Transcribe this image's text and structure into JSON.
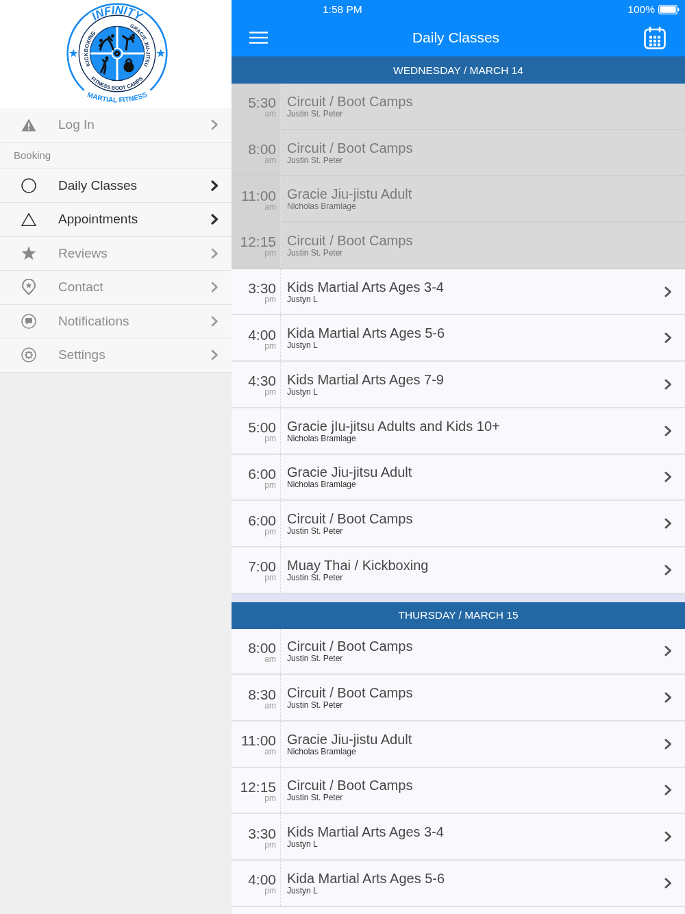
{
  "status_bar": {
    "time": "1:58 PM",
    "battery": "100%"
  },
  "logo": {
    "top_text": "INFINITY",
    "bottom_text": "MARTIAL FITNESS",
    "left_text": "KICKBOXING",
    "lower_text": "FITNESS BOOT CAMPS",
    "right_text": "GRACIE JIU-JITSU"
  },
  "sidebar": {
    "items": [
      {
        "kind": "item",
        "label": "Log In",
        "disabled": true
      },
      {
        "kind": "header",
        "label": "Booking"
      },
      {
        "kind": "item",
        "label": "Daily Classes",
        "disabled": false
      },
      {
        "kind": "item",
        "label": "Appointments",
        "disabled": false
      },
      {
        "kind": "item",
        "label": "Reviews",
        "disabled": true
      },
      {
        "kind": "item",
        "label": "Contact",
        "disabled": true
      },
      {
        "kind": "item",
        "label": "Notifications",
        "disabled": true
      },
      {
        "kind": "item",
        "label": "Settings",
        "disabled": true
      }
    ]
  },
  "nav_bar": {
    "title": "Daily Classes"
  },
  "days": [
    {
      "date": "WEDNESDAY / MARCH 14",
      "classes": [
        {
          "time": "5:30",
          "period": "am",
          "name": "Circuit / Boot Camps",
          "instructor": "Justin St. Peter",
          "past": true
        },
        {
          "time": "8:00",
          "period": "am",
          "name": "Circuit / Boot Camps",
          "instructor": "Justin St. Peter",
          "past": true
        },
        {
          "time": "11:00",
          "period": "am",
          "name": "Gracie Jiu-jistu Adult",
          "instructor": "Nicholas Bramlage",
          "past": true
        },
        {
          "time": "12:15",
          "period": "pm",
          "name": "Circuit / Boot Camps",
          "instructor": "Justin St. Peter",
          "past": true
        },
        {
          "time": "3:30",
          "period": "pm",
          "name": "Kids Martial Arts Ages 3-4",
          "instructor": "Justyn L",
          "past": false
        },
        {
          "time": "4:00",
          "period": "pm",
          "name": "Kida Martial Arts Ages 5-6",
          "instructor": "Justyn L",
          "past": false
        },
        {
          "time": "4:30",
          "period": "pm",
          "name": "Kids Martial Arts Ages 7-9",
          "instructor": "Justyn L",
          "past": false
        },
        {
          "time": "5:00",
          "period": "pm",
          "name": "Gracie jIu-jitsu Adults and Kids 10+",
          "instructor": "Nicholas Bramlage",
          "past": false
        },
        {
          "time": "6:00",
          "period": "pm",
          "name": "Gracie Jiu-jitsu Adult",
          "instructor": "Nicholas Bramlage",
          "past": false
        },
        {
          "time": "6:00",
          "period": "pm",
          "name": "Circuit / Boot Camps",
          "instructor": "Justin St. Peter",
          "past": false
        },
        {
          "time": "7:00",
          "period": "pm",
          "name": "Muay Thai / Kickboxing",
          "instructor": "Justin St. Peter",
          "past": false
        }
      ]
    },
    {
      "date": "THURSDAY / MARCH 15",
      "classes": [
        {
          "time": "8:00",
          "period": "am",
          "name": "Circuit / Boot Camps",
          "instructor": "Justin St. Peter",
          "past": false
        },
        {
          "time": "8:30",
          "period": "am",
          "name": "Circuit / Boot Camps",
          "instructor": "Justin St. Peter",
          "past": false
        },
        {
          "time": "11:00",
          "period": "am",
          "name": "Gracie Jiu-jistu Adult",
          "instructor": "Nicholas Bramlage",
          "past": false
        },
        {
          "time": "12:15",
          "period": "pm",
          "name": "Circuit / Boot Camps",
          "instructor": "Justin St. Peter",
          "past": false
        },
        {
          "time": "3:30",
          "period": "pm",
          "name": "Kids Martial Arts Ages 3-4",
          "instructor": "Justyn L",
          "past": false
        },
        {
          "time": "4:00",
          "period": "pm",
          "name": "Kida Martial Arts Ages 5-6",
          "instructor": "Justyn L",
          "past": false
        }
      ]
    }
  ]
}
